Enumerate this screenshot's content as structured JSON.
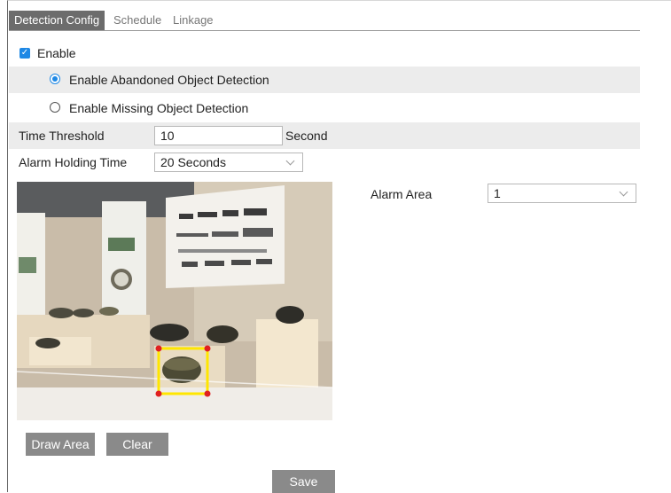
{
  "tabs": [
    {
      "label": "Detection Config",
      "active": true
    },
    {
      "label": "Schedule",
      "active": false
    },
    {
      "label": "Linkage",
      "active": false
    }
  ],
  "enable": {
    "label": "Enable",
    "checked": true
  },
  "abandoned": {
    "label": "Enable Abandoned Object Detection",
    "selected": true
  },
  "missing": {
    "label": "Enable Missing Object Detection",
    "selected": false
  },
  "time_threshold": {
    "label": "Time Threshold",
    "value": "10",
    "unit": "Second"
  },
  "alarm_holding": {
    "label": "Alarm Holding Time",
    "value": "20 Seconds"
  },
  "alarm_area": {
    "label": "Alarm Area",
    "value": "1"
  },
  "buttons": {
    "draw_area": "Draw Area",
    "clear": "Clear",
    "save": "Save"
  },
  "colors": {
    "accent": "#1e88e5",
    "button": "#8a8a8a",
    "tab_active": "#6c6c6c",
    "area_box": "#ffe600",
    "area_handle": "#e02020"
  },
  "icons": {
    "checkbox": "check-icon",
    "dropdown": "chevron-down-icon"
  }
}
